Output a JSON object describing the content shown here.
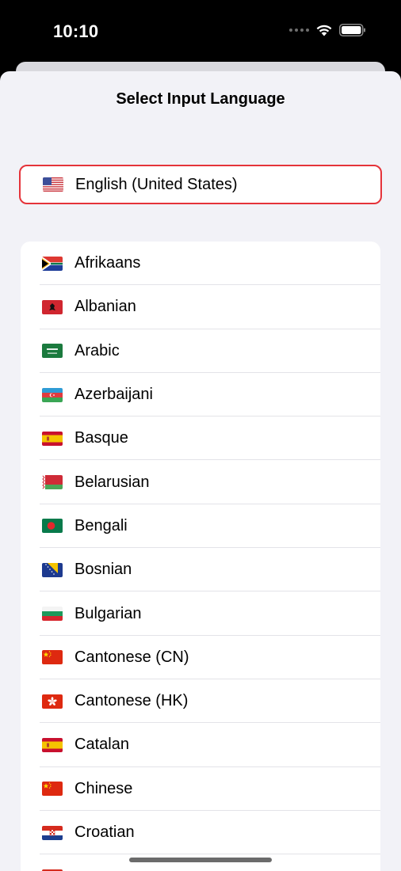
{
  "status_bar": {
    "time": "10:10"
  },
  "sheet": {
    "title": "Select Input Language"
  },
  "selected": {
    "label": "English (United States)",
    "flag": "us-flag"
  },
  "languages": [
    {
      "label": "Afrikaans",
      "flag": "za-flag"
    },
    {
      "label": "Albanian",
      "flag": "al-flag"
    },
    {
      "label": "Arabic",
      "flag": "sa-flag"
    },
    {
      "label": "Azerbaijani",
      "flag": "az-flag"
    },
    {
      "label": "Basque",
      "flag": "es-flag"
    },
    {
      "label": "Belarusian",
      "flag": "by-flag"
    },
    {
      "label": "Bengali",
      "flag": "bd-flag"
    },
    {
      "label": "Bosnian",
      "flag": "ba-flag"
    },
    {
      "label": "Bulgarian",
      "flag": "bg-flag"
    },
    {
      "label": "Cantonese (CN)",
      "flag": "cn-flag"
    },
    {
      "label": "Cantonese (HK)",
      "flag": "hk-flag"
    },
    {
      "label": "Catalan",
      "flag": "es-flag"
    },
    {
      "label": "Chinese",
      "flag": "cn-flag"
    },
    {
      "label": "Croatian",
      "flag": "hr-flag"
    },
    {
      "label": "",
      "flag": "partial-flag"
    }
  ],
  "colors": {
    "selection_border": "#e5333a",
    "background": "#f2f2f7"
  }
}
